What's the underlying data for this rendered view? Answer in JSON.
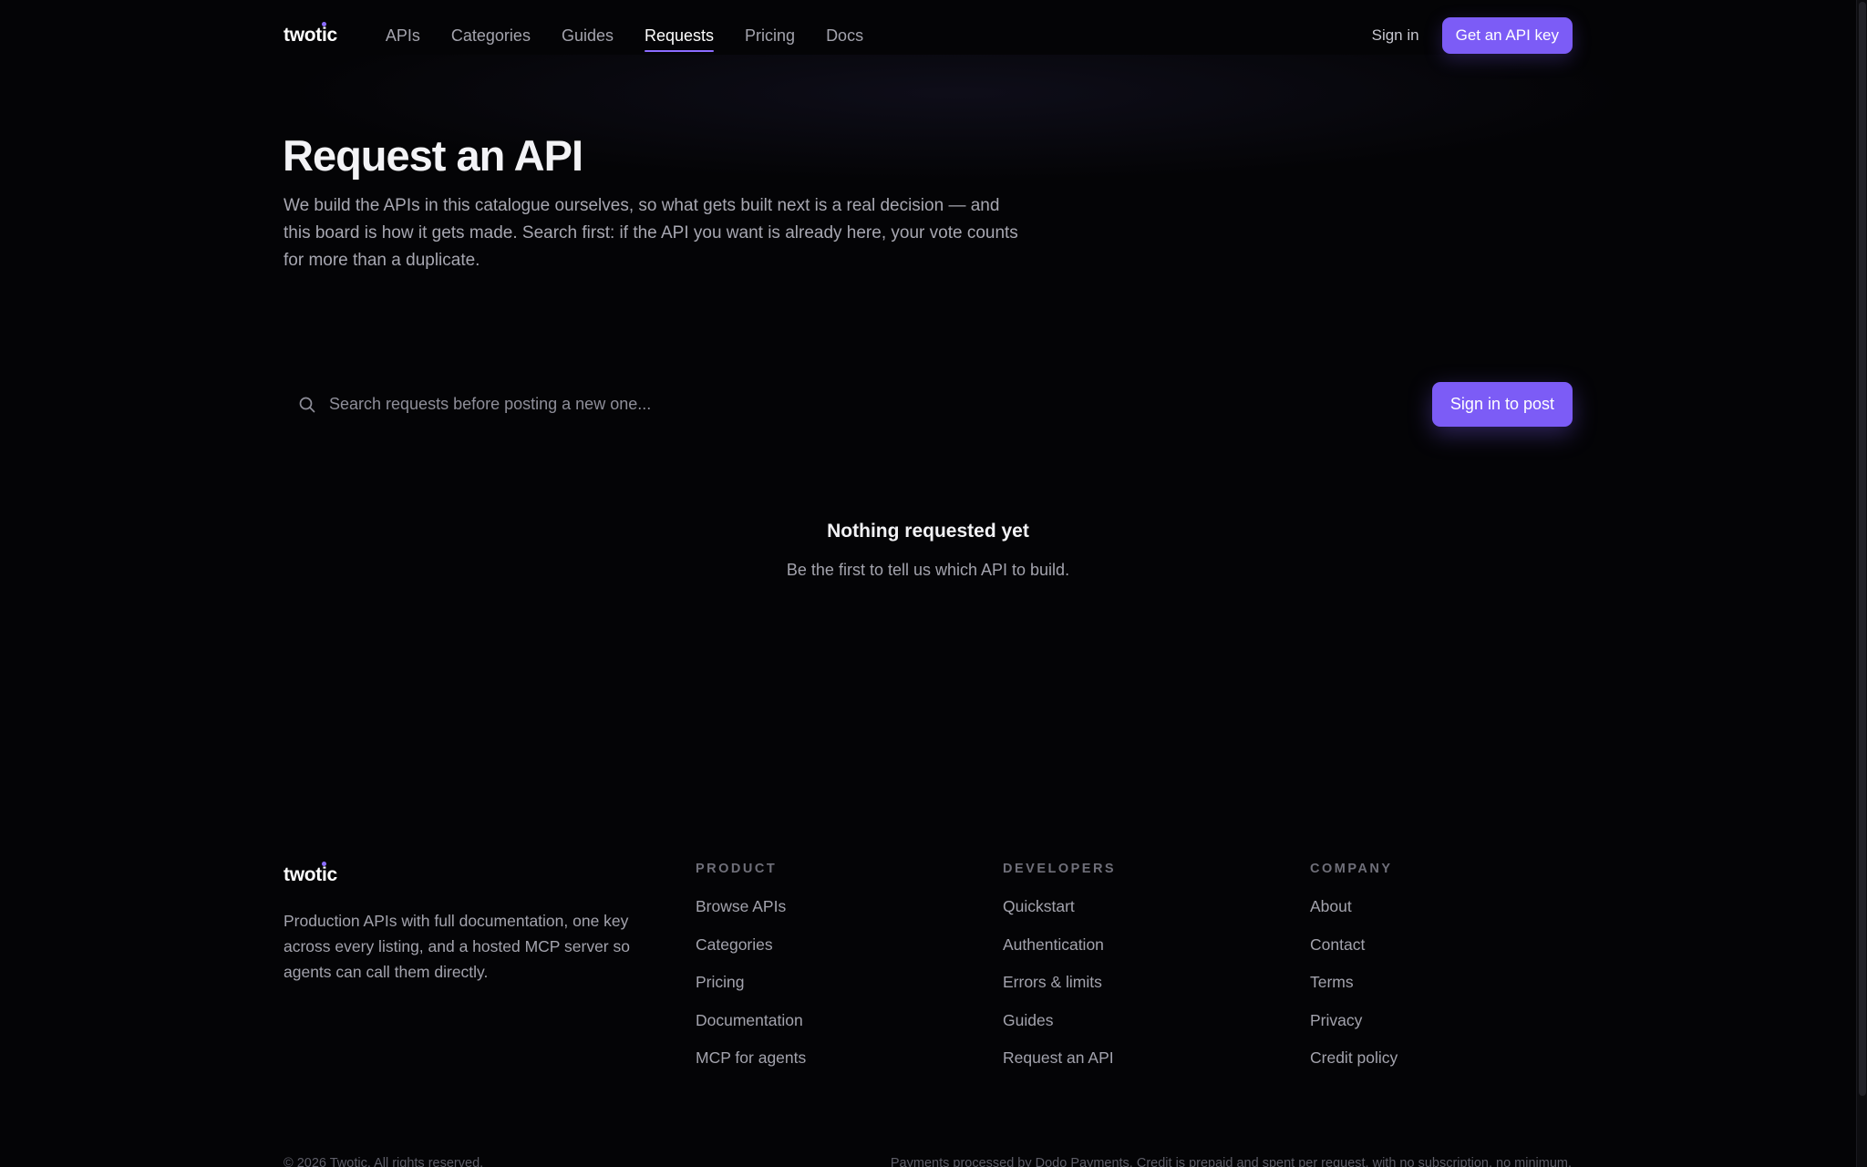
{
  "brand": {
    "name": "twotic",
    "accent": "#7c5cf6"
  },
  "nav": {
    "links": [
      "APIs",
      "Categories",
      "Guides",
      "Requests",
      "Pricing",
      "Docs"
    ],
    "active": "Requests",
    "signin_label": "Sign in",
    "cta_label": "Get an API key"
  },
  "hero": {
    "title": "Request an API",
    "description": "We build the APIs in this catalogue ourselves, so what gets built next is a real decision — and this board is how it gets made. Search first: if the API you want is already here, your vote counts for more than a duplicate."
  },
  "search": {
    "icon": "search-icon",
    "placeholder": "Search requests before posting a new one...",
    "value": "",
    "post_button_label": "Sign in to post"
  },
  "empty_state": {
    "title": "Nothing requested yet",
    "subtitle": "Be the first to tell us which API to build."
  },
  "footer": {
    "tagline": "Production APIs with full documentation, one key across every listing, and a hosted MCP server so agents can call them directly.",
    "columns": [
      {
        "heading": "PRODUCT",
        "items": [
          "Browse APIs",
          "Categories",
          "Pricing",
          "Documentation",
          "MCP for agents"
        ]
      },
      {
        "heading": "DEVELOPERS",
        "items": [
          "Quickstart",
          "Authentication",
          "Errors & limits",
          "Guides",
          "Request an API"
        ]
      },
      {
        "heading": "COMPANY",
        "items": [
          "About",
          "Contact",
          "Terms",
          "Privacy",
          "Credit policy"
        ]
      }
    ],
    "copyright": "© 2026 Twotic. All rights reserved.",
    "payments_note": "Payments processed by Dodo Payments. Credit is prepaid and spent per request, with no subscription, no minimum."
  }
}
